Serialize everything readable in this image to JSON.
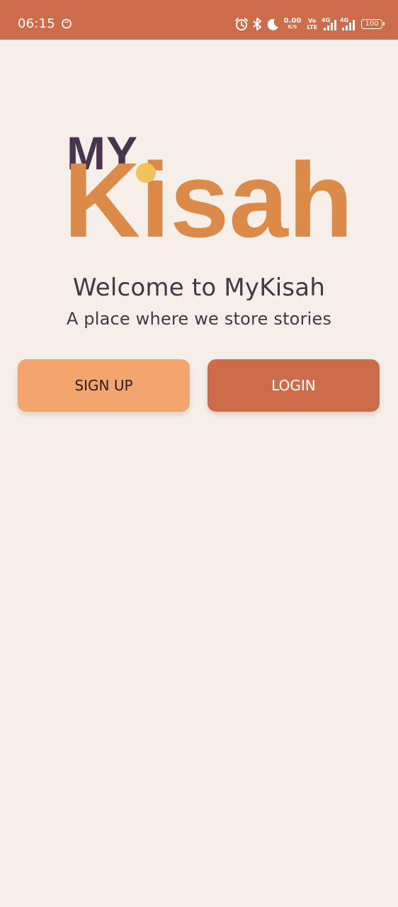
{
  "status_bar": {
    "time": "06:15",
    "net_speed_value": "0.00",
    "net_speed_unit": "K/S",
    "volte_top": "Vo",
    "volte_bottom": "LTE",
    "sim1_tag": "4G",
    "sim2_tag": "4G",
    "battery_level": "100",
    "icons": [
      "notification-icon",
      "alarm-icon",
      "bluetooth-icon",
      "moon-icon",
      "signal-icon",
      "battery-icon"
    ],
    "bar_color": "#cd6c4a"
  },
  "logo": {
    "top_text": "MY",
    "main_text": "Kisah",
    "colors": {
      "top": "#4a344f",
      "main": "#dc8a4a",
      "dot": "#f1c35d"
    }
  },
  "welcome": {
    "title": "Welcome to MyKisah",
    "subtitle": "A place where we store stories"
  },
  "buttons": {
    "signup_label": "SIGN UP",
    "login_label": "LOGIN",
    "signup_color": "#f4a46d",
    "login_color": "#cd6c4a"
  },
  "background_color": "#f6eee8"
}
